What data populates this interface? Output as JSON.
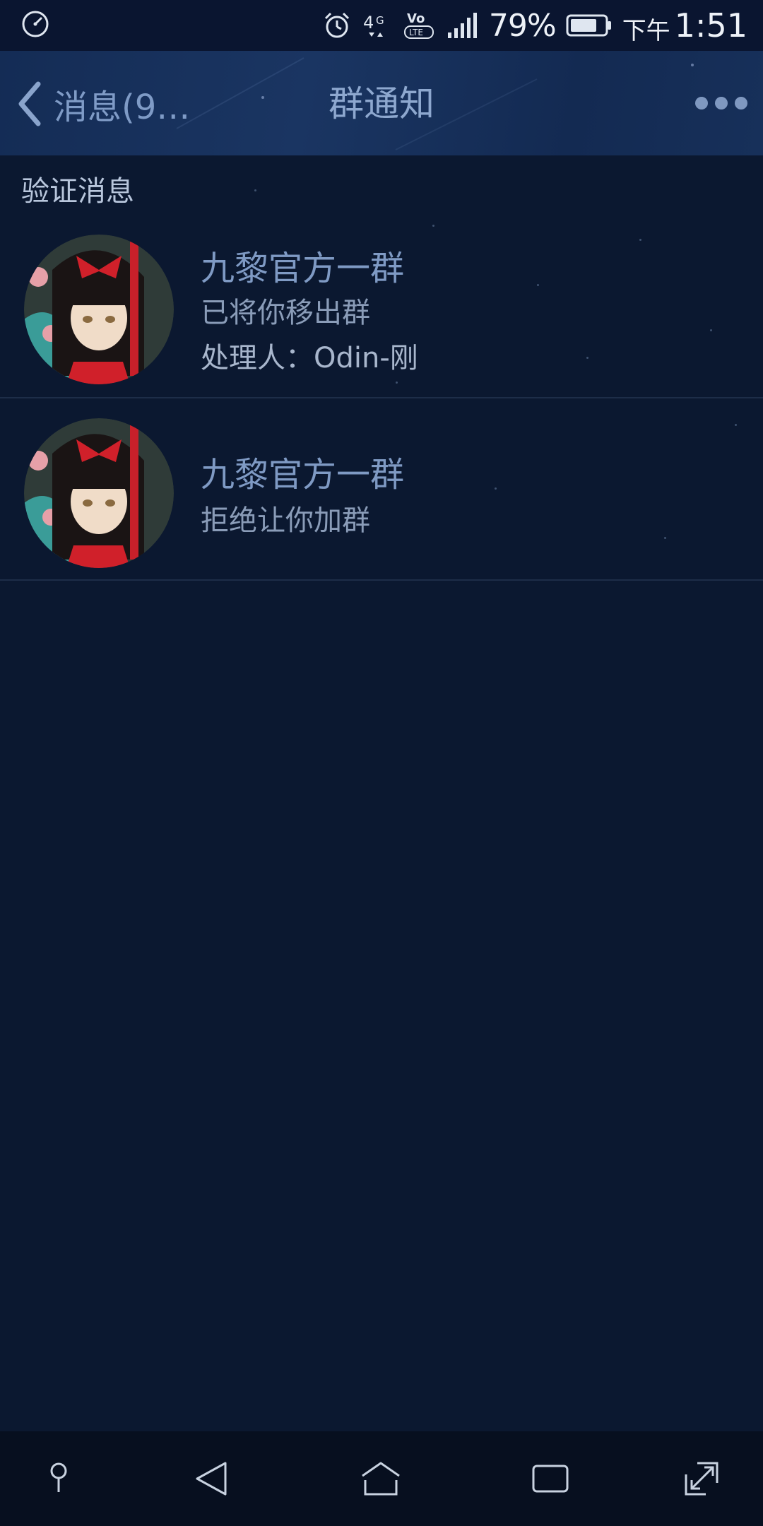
{
  "status_bar": {
    "battery_percent": "79%",
    "time_prefix": "下午",
    "time": "1:51",
    "icons": [
      "clock-icon",
      "alarm-icon",
      "network-4g-icon",
      "volte-icon",
      "signal-icon",
      "battery-icon"
    ]
  },
  "nav": {
    "back_label": "消息(9…",
    "title": "群通知",
    "more_icon": "more-icon"
  },
  "section": {
    "header": "验证消息"
  },
  "notifications": [
    {
      "group_name": "九黎官方一群",
      "message": "已将你移出群",
      "handler": "处理人：Odin-刚"
    },
    {
      "group_name": "九黎官方一群",
      "message": "拒绝让你加群"
    }
  ],
  "system_nav": {
    "icons": [
      "pin-icon",
      "back-triangle-icon",
      "home-icon",
      "recents-icon",
      "expand-icon"
    ]
  },
  "colors": {
    "background": "#0b1830",
    "nav_gradient": "#1a3562",
    "title_text": "#8ea8cf",
    "item_title": "#7f9ac4"
  }
}
